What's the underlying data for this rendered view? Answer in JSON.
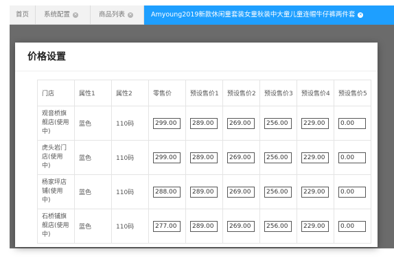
{
  "tabs": [
    {
      "label": "首页"
    },
    {
      "label": "系统配置"
    },
    {
      "label": "商品列表"
    },
    {
      "label": "Amyoung2019新款休闲童套装女童秋装中大童儿童连帽牛仔裤两件套"
    }
  ],
  "dialog": {
    "title": "价格设置",
    "headers": [
      "门店",
      "属性1",
      "属性2",
      "零售价",
      "预设售价1",
      "预设售价2",
      "预设售价3",
      "预设售价4",
      "预设售价5"
    ],
    "rows": [
      {
        "store": "观音桥旗舰店(使用中)",
        "attr1": "蓝色",
        "attr2": "110码",
        "prices": [
          "299.00",
          "289.00",
          "269.00",
          "256.00",
          "229.00",
          "0.00"
        ]
      },
      {
        "store": "虎头岩门店(使用中)",
        "attr1": "蓝色",
        "attr2": "110码",
        "prices": [
          "299.00",
          "289.00",
          "269.00",
          "256.00",
          "229.00",
          "0.00"
        ]
      },
      {
        "store": "杨家坪店铺(使用中)",
        "attr1": "蓝色",
        "attr2": "110码",
        "prices": [
          "288.00",
          "289.00",
          "269.00",
          "256.00",
          "229.00",
          "0.00"
        ]
      },
      {
        "store": "石桥铺旗舰店(使用中)",
        "attr1": "蓝色",
        "attr2": "110码",
        "prices": [
          "277.00",
          "289.00",
          "269.00",
          "256.00",
          "229.00",
          "0.00"
        ]
      }
    ]
  },
  "colors": {
    "active_tab": "#1e9fff",
    "mask": "#6b6b6b"
  }
}
